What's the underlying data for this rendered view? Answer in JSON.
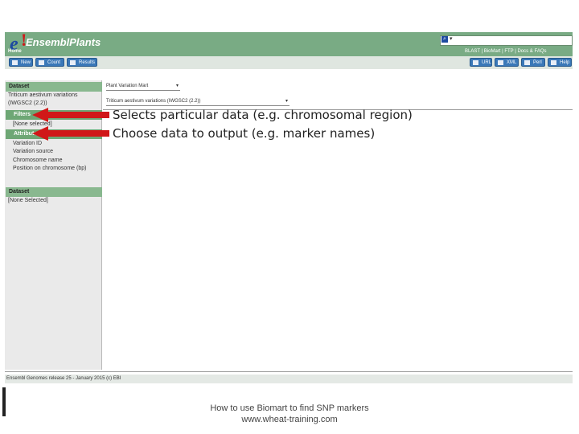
{
  "header": {
    "logo_e": "e",
    "logo_bang": "!",
    "logo_text": "EnsemblPlants",
    "home": "Home",
    "search_dropdown": "▾",
    "top_links": "BLAST  |  BioMart  |  FTP  |  Docs & FAQs"
  },
  "toolbar": {
    "new": "New",
    "count": "Count",
    "results": "Results",
    "url": "URL",
    "xml": "XML",
    "perl": "Perl",
    "help": "Help"
  },
  "left_panel": {
    "dataset1_header": "Dataset",
    "dataset1_line1": "Triticum aestivum variations",
    "dataset1_line2": "(IWGSC2 (2.2))",
    "filters": "Filters",
    "filters_value": "[None selected]",
    "attributes": "Attributes",
    "attr_items": [
      "Variation ID",
      "Variation source",
      "Chromosome name",
      "Position on chromosome (bp)"
    ],
    "dataset2_header": "Dataset",
    "dataset2_value": "[None Selected]"
  },
  "main": {
    "mart_select": "Plant Variation Mart",
    "dataset_select": "Triticum aestivum variations (IWGSC2 (2.2))"
  },
  "annotations": {
    "filters_note": "Selects particular data (e.g. chromosomal region)",
    "attributes_note": "Choose data to output (e.g. marker names)"
  },
  "footer": {
    "release": "Ensembl Genomes release 25 - January 2015 (c) EBI",
    "caption_line1": "How to use Biomart to find SNP markers",
    "caption_line2": "www.wheat-training.com"
  },
  "colors": {
    "header": "#79ab84",
    "arrow": "#d01818",
    "button": "#3a78b8"
  }
}
